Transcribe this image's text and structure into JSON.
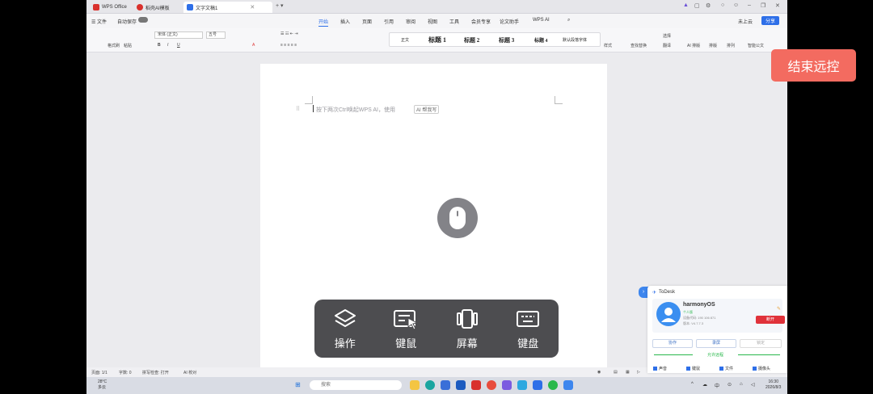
{
  "tabs": [
    {
      "label": "WPS Office",
      "color": "#d9302c"
    },
    {
      "label": "稻壳AI模板",
      "color": "#d9302c"
    },
    {
      "label": "文字文稿1",
      "color": "#2e6fe8"
    }
  ],
  "menu": {
    "file": "文件",
    "autosave": "自动保存",
    "items": [
      "开始",
      "插入",
      "页面",
      "引用",
      "审阅",
      "视图",
      "工具",
      "会员专享",
      "论文助手",
      "WPS AI"
    ],
    "active": "开始",
    "cloud": "未上云",
    "share": "分享"
  },
  "toolbar": {
    "format_painter": "格式刷",
    "paste": "粘贴",
    "font_name": "宋体 (正文)",
    "font_size": "五号",
    "styles": [
      "正文",
      "标题 1",
      "标题 2",
      "标题 3",
      "标题 4",
      "默认段落字体"
    ],
    "style_label": "样式",
    "find_replace": "查找替换",
    "select": "选择",
    "translate": "翻译",
    "ai_layout": "AI 排版",
    "layout": "排版",
    "sort": "排列",
    "smart_doc": "智能公文"
  },
  "document": {
    "placeholder": "按下两次Ctrl唤起WPS AI，使用",
    "ai_chip": "AI 帮我写"
  },
  "statusbar": {
    "page": "页面: 1/1",
    "words": "字数: 0",
    "spell": "拼写检查: 打开",
    "ai_check": "AI 校对"
  },
  "taskbar": {
    "temp": "28°C",
    "weather": "多云",
    "search_placeholder": "搜索",
    "ime": "中",
    "time": "16:30",
    "date": "2026/8/3"
  },
  "remote": {
    "end_label": "结束远控",
    "controls": [
      {
        "label": "操作",
        "icon": "layers-icon"
      },
      {
        "label": "键鼠",
        "icon": "keyboard-mouse-icon"
      },
      {
        "label": "屏幕",
        "icon": "screen-icon"
      },
      {
        "label": "键盘",
        "icon": "keyboard-icon"
      }
    ]
  },
  "todesk": {
    "brand": "ToDesk",
    "device_name": "harmonyOS",
    "tag": "个人版",
    "device_code": "设备代码: 190 106 871",
    "version": "版本: V4.7.7.3",
    "disconnect": "断开",
    "btn_collab": "协作",
    "btn_record": "录屏",
    "btn_lock": "锁定",
    "allow_label": "允许远程",
    "checks": [
      "声音",
      "键鼠",
      "文件",
      "摄像头"
    ]
  }
}
